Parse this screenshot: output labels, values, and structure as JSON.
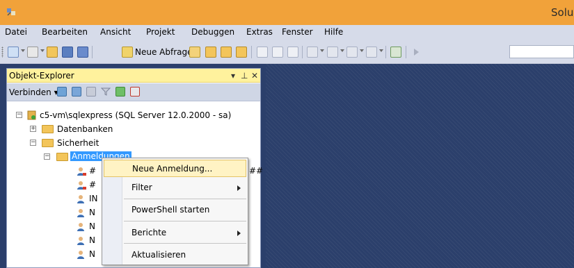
{
  "window": {
    "title": "Solu",
    "accent": "#f1a23a"
  },
  "menubar": {
    "items": [
      "Datei",
      "Bearbeiten",
      "Ansicht",
      "Projekt",
      "Debuggen",
      "Extras",
      "Fenster",
      "Hilfe"
    ]
  },
  "toolbar": {
    "new_query_label": "Neue Abfrage"
  },
  "object_explorer": {
    "title": "Objekt-Explorer",
    "connect_label": "Verbinden",
    "tree": {
      "server": "c5-vm\\sqlexpress (SQL Server 12.0.2000 - sa)",
      "databases": "Datenbanken",
      "security": "Sicherheit",
      "logins": "Anmeldungen",
      "login_items": [
        "#",
        "#",
        "IN",
        "N",
        "N",
        "N",
        "N"
      ],
      "partial_suffix": "##"
    }
  },
  "context_menu": {
    "new_login": "Neue Anmeldung...",
    "filter": "Filter",
    "powershell": "PowerShell starten",
    "reports": "Berichte",
    "refresh": "Aktualisieren"
  },
  "colors": {
    "panel_header": "#fff29d",
    "workspace": "#2b3f6b",
    "selection": "#3399ff",
    "menu_highlight": "#fff3c4"
  }
}
